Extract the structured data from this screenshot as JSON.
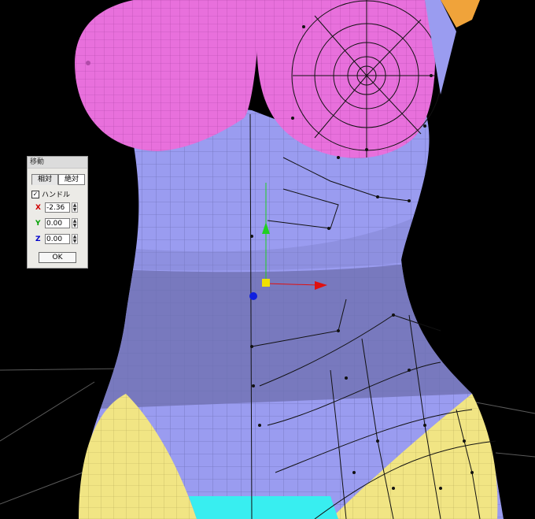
{
  "panel": {
    "title": "移動",
    "tab_relative": "相対",
    "tab_absolute": "絶対",
    "handle_label": "ハンドル",
    "handle_checked": true,
    "x_label": "X",
    "x_value": "-2.36",
    "y_label": "Y",
    "y_value": "0.00",
    "z_label": "Z",
    "z_value": "0.00",
    "ok_label": "OK"
  },
  "colors": {
    "background": "#000000",
    "breast_pink": "#e870dc",
    "torso_blue": "#9a9cf0",
    "waist_dark": "#6c6dad",
    "hip_yellow": "#f1e584",
    "crotch_cyan": "#38eef0",
    "arm_orange": "#f0a33a",
    "x_axis": "#e01010",
    "y_axis": "#20d020",
    "z_axis": "#1020e0",
    "handle": "#f0e000"
  },
  "icons": {
    "checkbox": "checkmark-icon",
    "spinner": "spin-arrows-icon"
  }
}
